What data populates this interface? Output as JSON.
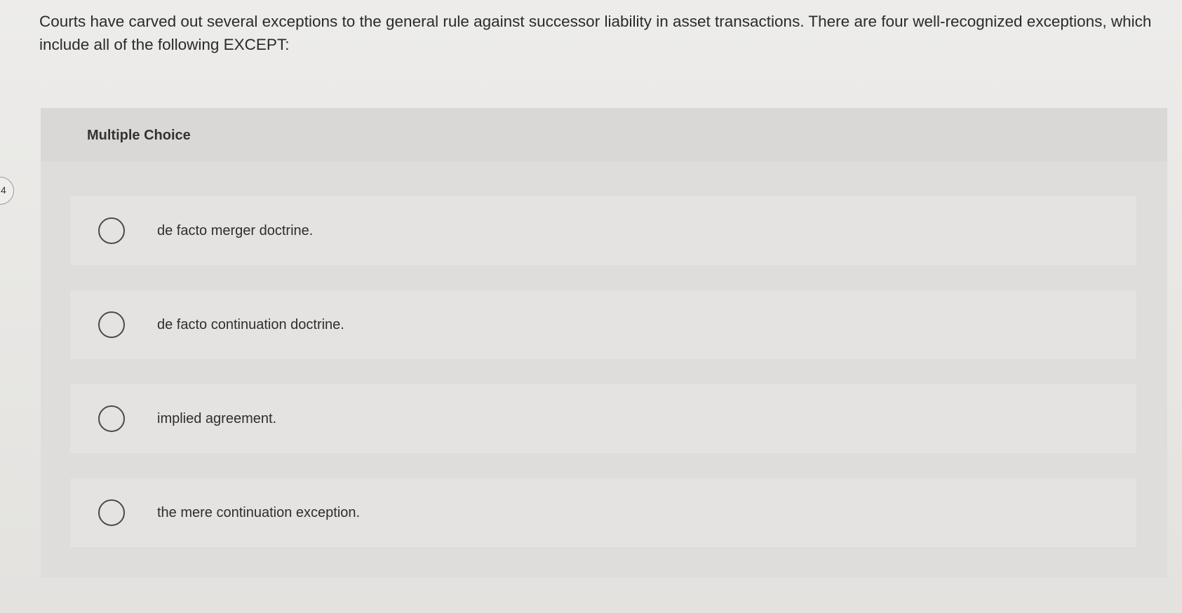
{
  "question": {
    "text": "Courts have carved out several exceptions to the general rule against successor liability in asset transactions. There are four well-recognized exceptions, which include all of the following EXCEPT:"
  },
  "side_marker": {
    "label": "4"
  },
  "panel": {
    "title": "Multiple Choice",
    "options": [
      {
        "label": "de facto merger doctrine."
      },
      {
        "label": "de facto continuation doctrine."
      },
      {
        "label": "implied agreement."
      },
      {
        "label": "the mere continuation exception."
      }
    ]
  }
}
